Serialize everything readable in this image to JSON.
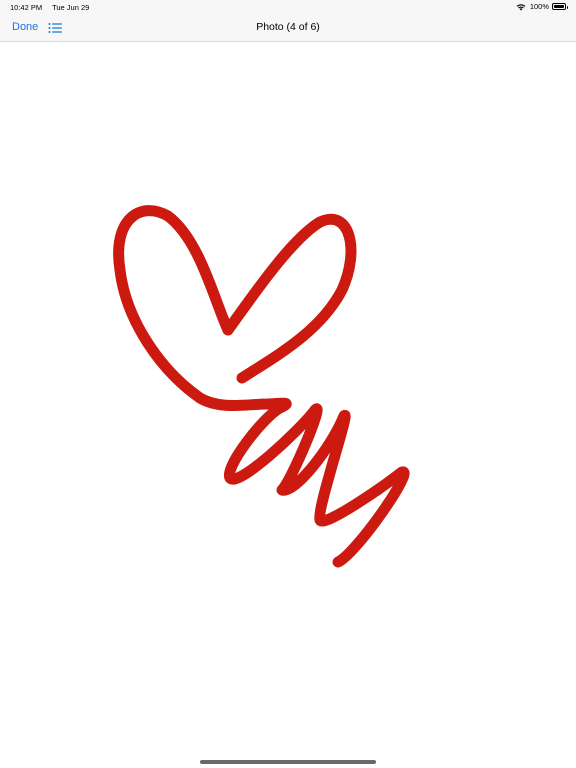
{
  "status_bar": {
    "time": "10:42 PM",
    "date": "Tue Jun 29",
    "battery_percent": "100%",
    "battery_level": 1.0,
    "wifi_icon": "wifi-icon"
  },
  "nav": {
    "done_label": "Done",
    "list_icon": "list-icon",
    "title": "Photo (4 of 6)"
  },
  "photo": {
    "stroke_color": "#cc1a10",
    "background_color": "#ffffff"
  }
}
